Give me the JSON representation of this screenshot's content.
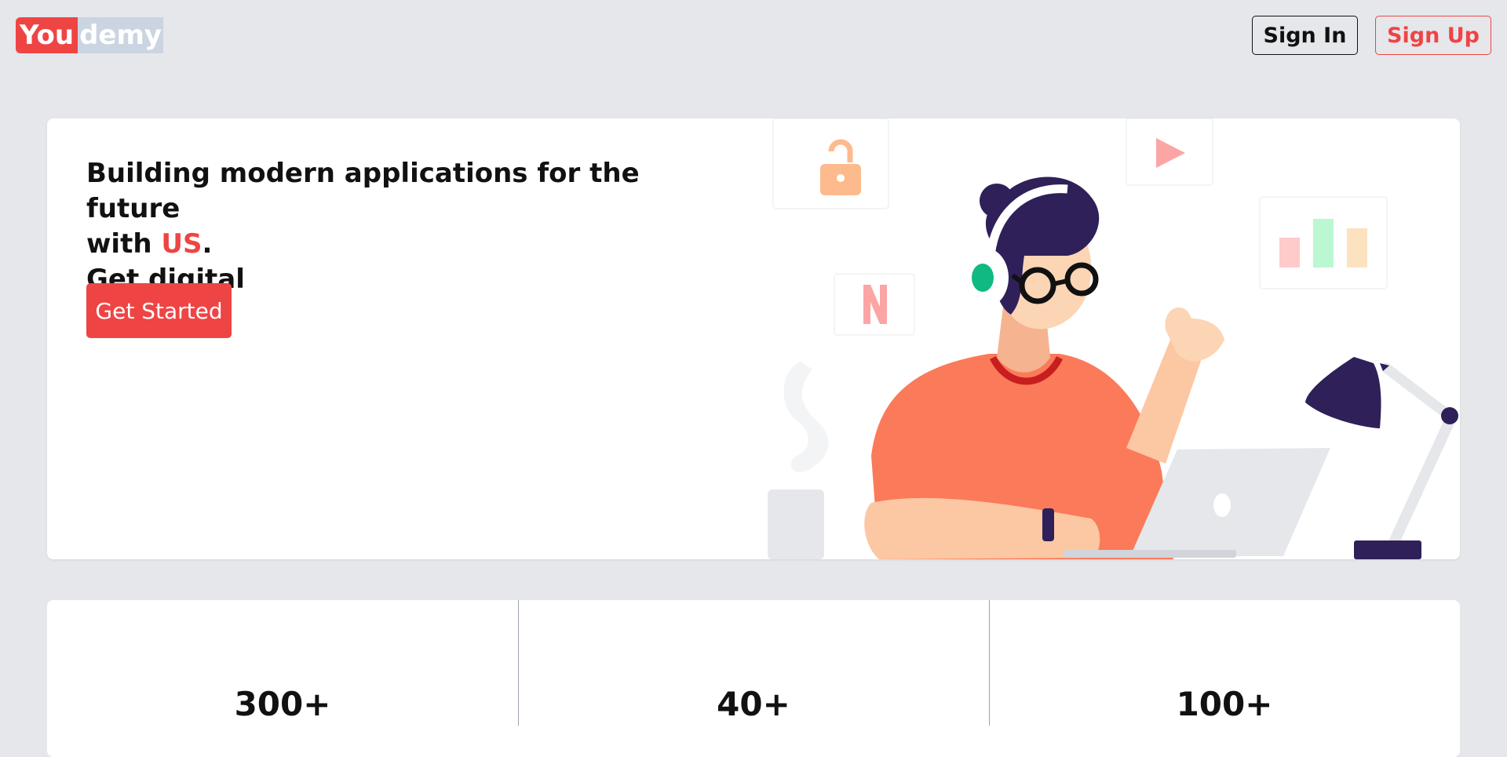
{
  "header": {
    "logo": {
      "part1": "You",
      "part2": "demy"
    },
    "sign_in_label": "Sign In",
    "sign_up_label": "Sign Up"
  },
  "hero": {
    "line1": "Building modern applications for the future",
    "line2_prefix": "with ",
    "line2_accent": "US",
    "line2_suffix": ".",
    "line3": "Get digital",
    "cta_label": "Get Started",
    "illustration": {
      "subject": "person-with-headphones-at-laptop",
      "icons": [
        "lock-icon",
        "play-icon",
        "netflix-n-icon",
        "bar-chart-icon",
        "coffee-mug-icon",
        "desk-lamp-icon"
      ]
    }
  },
  "stats": [
    {
      "value": "300+"
    },
    {
      "value": "40+"
    },
    {
      "value": "100+"
    }
  ],
  "colors": {
    "accent": "#ef4444",
    "background": "#e5e7eb",
    "card": "#ffffff",
    "illustration_navy": "#2f2059",
    "illustration_orange": "#fb7a5a"
  }
}
